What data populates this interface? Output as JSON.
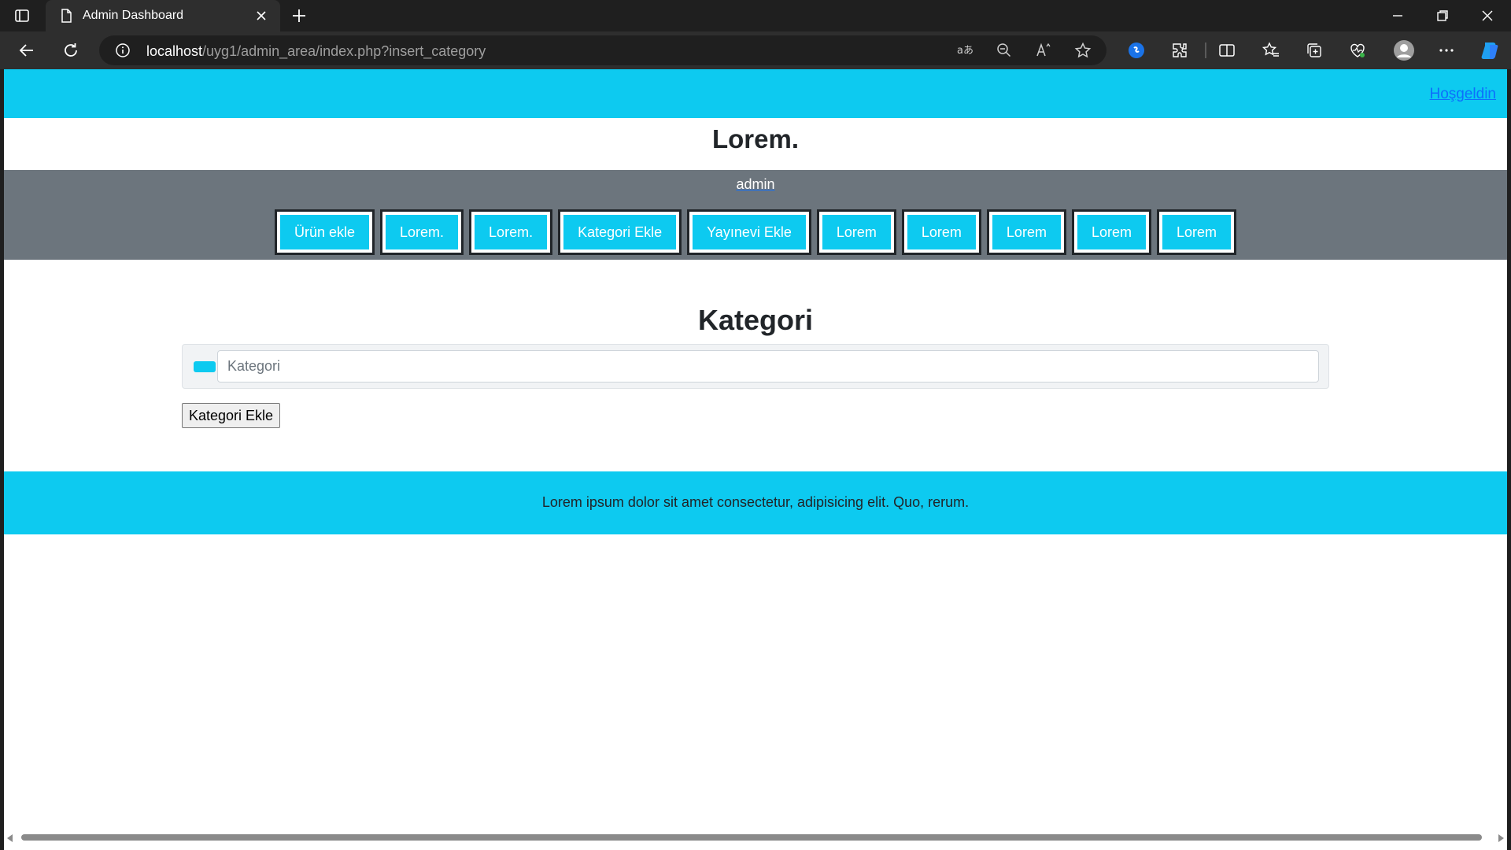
{
  "browser": {
    "tab_title": "Admin Dashboard",
    "url_host": "localhost",
    "url_path": "/uyg1/admin_area/index.php?insert_category",
    "icons": [
      "sidebar-icon",
      "document-icon",
      "close-icon",
      "plus-icon",
      "minimize-icon",
      "restore-icon",
      "close-window-icon",
      "back-icon",
      "reload-icon",
      "info-icon",
      "translate-icon",
      "zoom-out-icon",
      "read-aloud-icon",
      "favorite-star-icon",
      "shazam-icon",
      "extensions-icon",
      "split-screen-icon",
      "favorites-icon",
      "collections-icon",
      "performance-icon",
      "profile-icon",
      "more-icon",
      "copilot-icon"
    ]
  },
  "header": {
    "welcome_link": "Hoşgeldin",
    "site_title": "Lorem."
  },
  "nav": {
    "user": "admin",
    "buttons": [
      "Ürün ekle",
      "Lorem.",
      "Lorem.",
      "Kategori Ekle",
      "Yayınevi Ekle",
      "Lorem",
      "Lorem",
      "Lorem",
      "Lorem",
      "Lorem"
    ]
  },
  "form": {
    "heading": "Kategori",
    "category_placeholder": "Kategori",
    "submit_label": "Kategori Ekle"
  },
  "footer": {
    "text": "Lorem ipsum dolor sit amet consectetur, adipisicing elit. Quo, rerum."
  },
  "colors": {
    "accent": "#0dcaf0",
    "nav_bg": "#6c757d",
    "link": "#0d6efd"
  }
}
